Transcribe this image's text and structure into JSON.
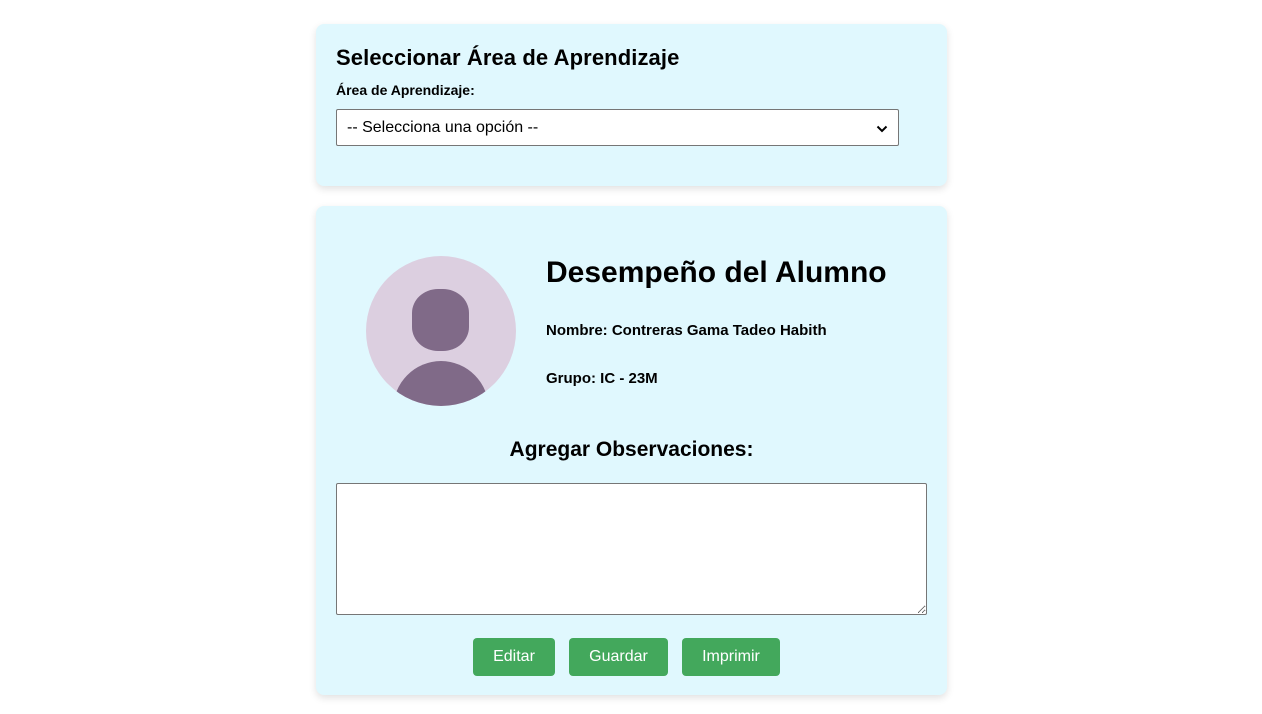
{
  "area_section": {
    "title": "Seleccionar Área de Aprendizaje",
    "label": "Área de Aprendizaje:",
    "select_value": "-- Selecciona una opción --",
    "select_icon": "chevron-down-icon"
  },
  "student_section": {
    "avatar_icon": "user-avatar-icon",
    "title": "Desempeño del Alumno",
    "name": "Nombre: Contreras Gama Tadeo Habith",
    "group": "Grupo: IC - 23M"
  },
  "observations": {
    "title": "Agregar Observaciones:",
    "value": ""
  },
  "actions": {
    "edit_label": "Editar",
    "save_label": "Guardar",
    "print_label": "Imprimir"
  },
  "colors": {
    "card_background": "#e0f8fe",
    "button_green": "#43a85c",
    "avatar_bg": "#dccfe0",
    "avatar_fg": "#806a88"
  }
}
